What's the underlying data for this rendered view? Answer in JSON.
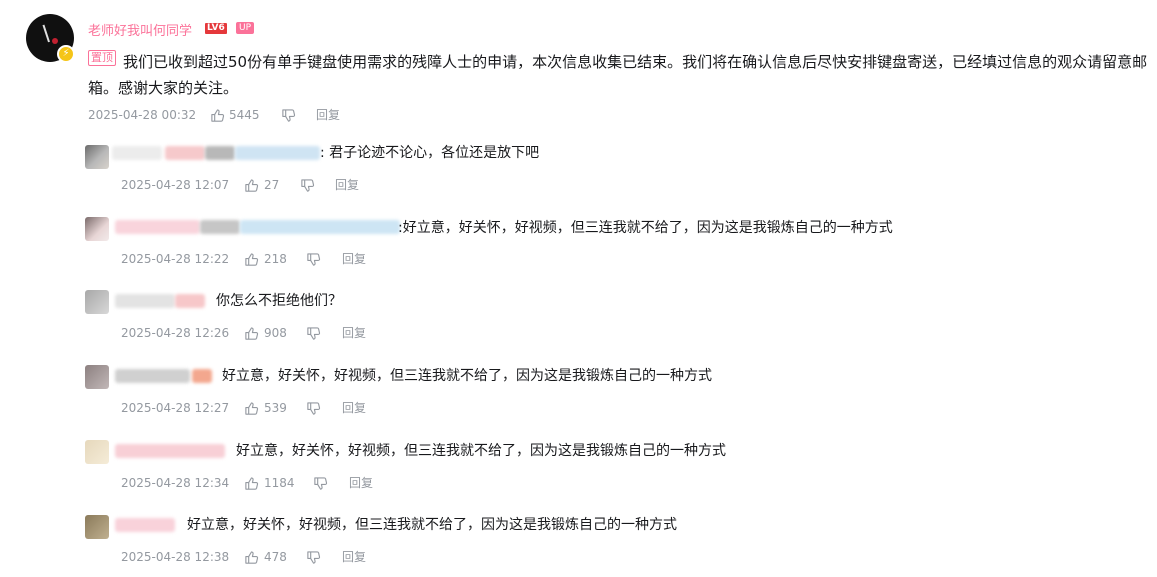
{
  "main": {
    "username": "老师好我叫何同学",
    "level_badge": "LV6",
    "up_badge": "UP",
    "pin_tag": "置顶",
    "content": "我们已收到超过50份有单手键盘使用需求的残障人士的申请，本次信息收集已结束。我们将在确认信息后尽快安排键盘寄送，已经填过信息的观众请留意邮箱。感谢大家的关注。",
    "time": "2025-04-28 00:32",
    "likes": "5445",
    "reply_label": "回复"
  },
  "replies": [
    {
      "text": ": 君子论迹不论心，各位还是放下吧",
      "time": "2025-04-28 12:07",
      "likes": "27",
      "reply_label": "回复"
    },
    {
      "text": ":好立意，好关怀，好视频，但三连我就不给了，因为这是我锻炼自己的一种方式",
      "time": "2025-04-28 12:22",
      "likes": "218",
      "reply_label": "回复"
    },
    {
      "text": "你怎么不拒绝他们？",
      "time": "2025-04-28 12:26",
      "likes": "908",
      "reply_label": "回复"
    },
    {
      "text": "好立意，好关怀，好视频，但三连我就不给了，因为这是我锻炼自己的一种方式",
      "time": "2025-04-28 12:27",
      "likes": "539",
      "reply_label": "回复"
    },
    {
      "text": "好立意，好关怀，好视频，但三连我就不给了，因为这是我锻炼自己的一种方式",
      "time": "2025-04-28 12:34",
      "likes": "1184",
      "reply_label": "回复"
    },
    {
      "text": "好立意，好关怀，好视频，但三连我就不给了，因为这是我锻炼自己的一种方式",
      "time": "2025-04-28 12:38",
      "likes": "478",
      "reply_label": "回复"
    }
  ],
  "icons": {
    "like": "thumbs-up-icon",
    "dislike": "thumbs-down-icon",
    "verified": "lightning-icon"
  },
  "colors": {
    "accent": "#fb7299",
    "meta": "#9499a0",
    "text": "#18191c"
  }
}
